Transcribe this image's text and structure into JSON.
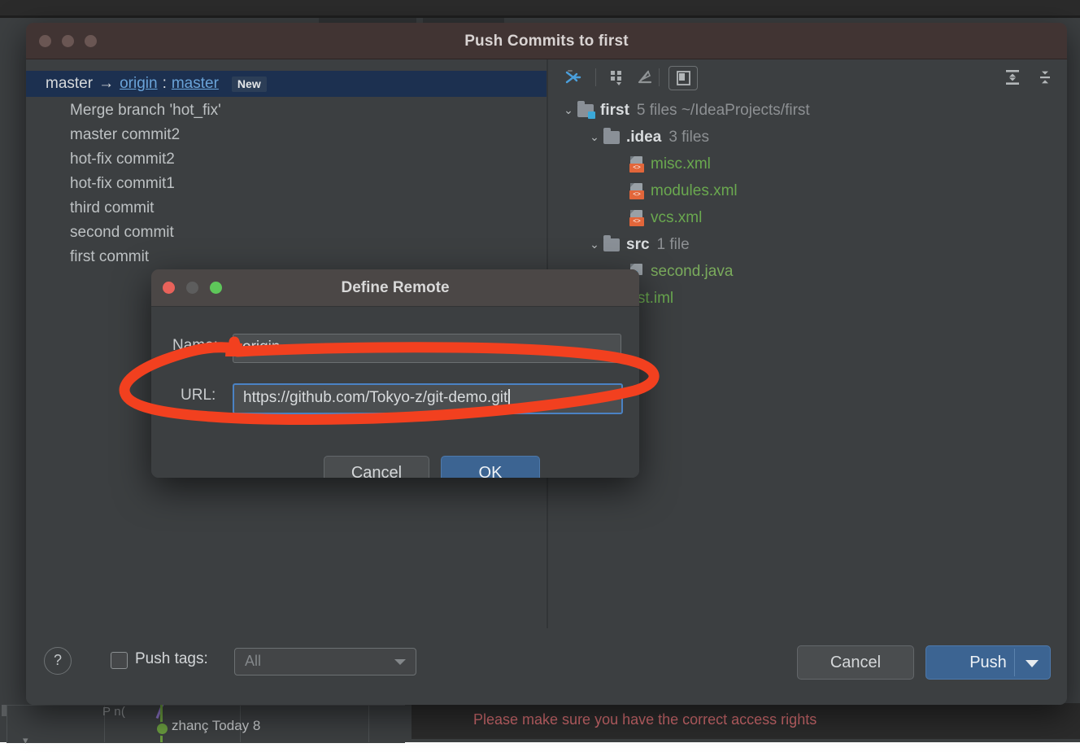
{
  "ide_background": {
    "branch_label_partial": "P n(",
    "commit_author_partial": "zhanç Today 8",
    "error_message": "Please make sure you have the correct access rights"
  },
  "window": {
    "title": "Push Commits to first",
    "traffic_lights": [
      "close",
      "minimize",
      "zoom"
    ]
  },
  "push_panel": {
    "branch_row": {
      "local_branch": "master",
      "arrow": "→",
      "remote_name": "origin",
      "separator": ":",
      "remote_branch": "master",
      "badge": "New"
    },
    "commits": [
      "Merge branch 'hot_fix'",
      "master commit2",
      "hot-fix commit2",
      "hot-fix commit1",
      "third commit",
      "second commit",
      "first commit"
    ]
  },
  "file_toolbar": {
    "items": [
      {
        "name": "collapse-selection-icon",
        "glyph": "→|"
      },
      {
        "name": "group-by-icon",
        "glyph": "☷"
      },
      {
        "name": "edit-icon",
        "glyph": "✎"
      },
      {
        "name": "preview-diff-icon",
        "glyph": "▣"
      },
      {
        "name": "expand-all-icon",
        "glyph": "⬍"
      },
      {
        "name": "collapse-all-icon",
        "glyph": "⬌"
      }
    ]
  },
  "file_tree": [
    {
      "level": 0,
      "chevron": "⌄",
      "icon": "project-folder-icon",
      "name": "first",
      "meta": "5 files  ~/IdeaProjects/first",
      "kind": "project"
    },
    {
      "level": 1,
      "chevron": "⌄",
      "icon": "folder-icon",
      "name": ".idea",
      "meta": "3 files",
      "kind": "folder"
    },
    {
      "level": 2,
      "chevron": "",
      "icon": "xml-file-icon",
      "name": "misc.xml",
      "meta": "",
      "kind": "xml"
    },
    {
      "level": 2,
      "chevron": "",
      "icon": "xml-file-icon",
      "name": "modules.xml",
      "meta": "",
      "kind": "xml"
    },
    {
      "level": 2,
      "chevron": "",
      "icon": "xml-file-icon",
      "name": "vcs.xml",
      "meta": "",
      "kind": "xml"
    },
    {
      "level": 1,
      "chevron": "⌄",
      "icon": "folder-icon",
      "name": "src",
      "meta": "1 file",
      "kind": "folder"
    },
    {
      "level": 2,
      "chevron": "",
      "icon": "java-file-icon",
      "name": "second.java",
      "meta": "",
      "kind": "java"
    },
    {
      "level": 1,
      "chevron": "",
      "icon": "iml-file-icon",
      "name": "first.iml",
      "meta": "",
      "kind": "iml"
    }
  ],
  "footer": {
    "help_label": "?",
    "push_tags_label": "Push tags:",
    "push_tags_checked": false,
    "tags_select_value": "All",
    "cancel_label": "Cancel",
    "push_label": "Push"
  },
  "define_remote_dialog": {
    "title": "Define Remote",
    "name_label": "Name:",
    "name_value": "origin",
    "url_label": "URL:",
    "url_value": "https://github.com/Tokyo-z/git-demo.git",
    "cancel_label": "Cancel",
    "ok_label": "OK"
  },
  "annotation": {
    "shape": "hand-drawn-red-ellipse",
    "color": "#f2401f",
    "target": "URL field"
  }
}
